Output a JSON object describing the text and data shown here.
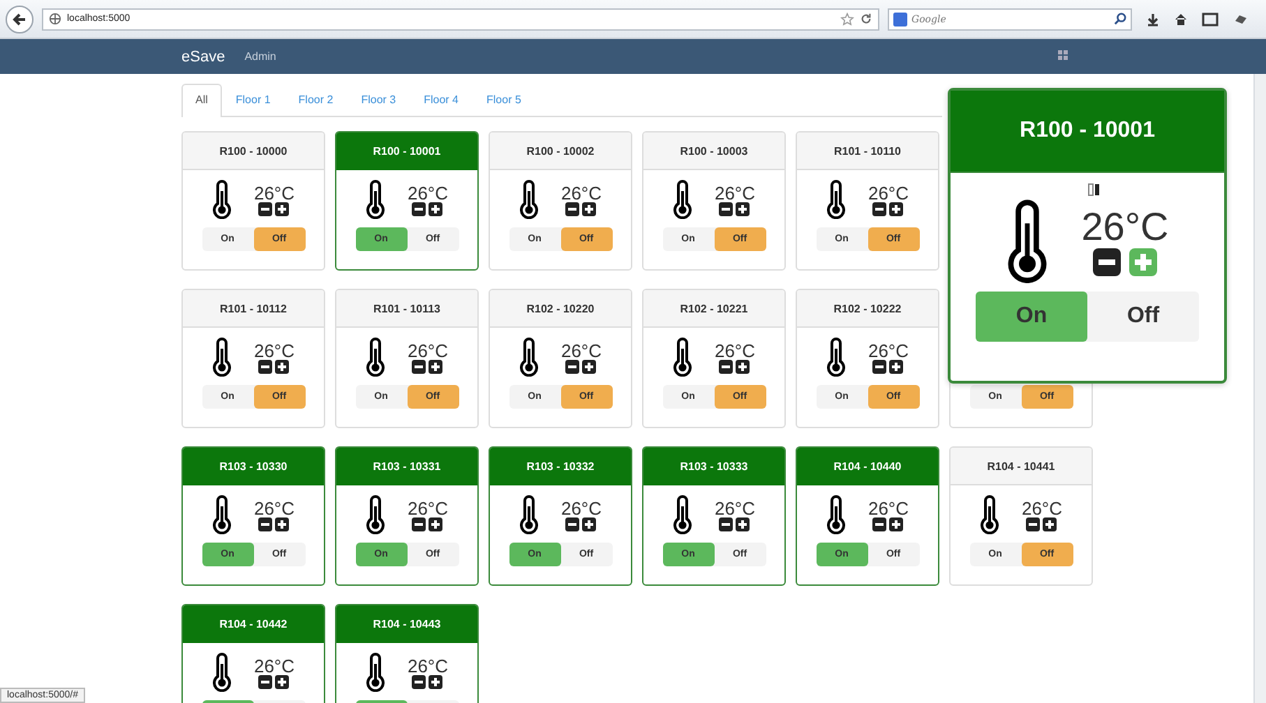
{
  "browser": {
    "address": "localhost:5000",
    "search_placeholder": "Google",
    "status": "localhost:5000/#"
  },
  "navbar": {
    "brand": "eSave",
    "links": [
      "Admin"
    ]
  },
  "tabs": [
    {
      "label": "All",
      "selected": true
    },
    {
      "label": "Floor 1",
      "selected": false
    },
    {
      "label": "Floor 2",
      "selected": false
    },
    {
      "label": "Floor 3",
      "selected": false
    },
    {
      "label": "Floor 4",
      "selected": false
    },
    {
      "label": "Floor 5",
      "selected": false
    }
  ],
  "rows": [
    [
      {
        "title": "R100 - 10000",
        "temperature": "26°C",
        "on_label": "On",
        "off_label": "Off",
        "on": false
      },
      {
        "title": "R100 - 10001",
        "temperature": "26°C",
        "on_label": "On",
        "off_label": "Off",
        "on": true
      },
      {
        "title": "R100 - 10002",
        "temperature": "26°C",
        "on_label": "On",
        "off_label": "Off",
        "on": false
      },
      {
        "title": "R100 - 10003",
        "temperature": "26°C",
        "on_label": "On",
        "off_label": "Off",
        "on": false
      },
      {
        "title": "R101 - 10110",
        "temperature": "26°C",
        "on_label": "On",
        "off_label": "Off",
        "on": false
      }
    ],
    [
      {
        "title": "R101 - 10112",
        "temperature": "26°C",
        "on_label": "On",
        "off_label": "Off",
        "on": false
      },
      {
        "title": "R101 - 10113",
        "temperature": "26°C",
        "on_label": "On",
        "off_label": "Off",
        "on": false
      },
      {
        "title": "R102 - 10220",
        "temperature": "26°C",
        "on_label": "On",
        "off_label": "Off",
        "on": false
      },
      {
        "title": "R102 - 10221",
        "temperature": "26°C",
        "on_label": "On",
        "off_label": "Off",
        "on": false
      },
      {
        "title": "R102 - 10222",
        "temperature": "26°C",
        "on_label": "On",
        "off_label": "Off",
        "on": false
      },
      {
        "on_label": "On",
        "off_label": "Off",
        "on": false
      }
    ],
    [
      {
        "title": "R103 - 10330",
        "temperature": "26°C",
        "on_label": "On",
        "off_label": "Off",
        "on": true
      },
      {
        "title": "R103 - 10331",
        "temperature": "26°C",
        "on_label": "On",
        "off_label": "Off",
        "on": true
      },
      {
        "title": "R103 - 10332",
        "temperature": "26°C",
        "on_label": "On",
        "off_label": "Off",
        "on": true
      },
      {
        "title": "R103 - 10333",
        "temperature": "26°C",
        "on_label": "On",
        "off_label": "Off",
        "on": true
      },
      {
        "title": "R104 - 10440",
        "temperature": "26°C",
        "on_label": "On",
        "off_label": "Off",
        "on": true
      },
      {
        "title": "R104 - 10441",
        "temperature": "26°C",
        "on_label": "On",
        "off_label": "Off",
        "on": false
      }
    ],
    [
      {
        "title": "R104 - 10442",
        "temperature": "26°C",
        "on": true
      },
      {
        "title": "R104 - 10443",
        "temperature": "26°C",
        "on": true
      }
    ]
  ],
  "popup": {
    "title": "R100 - 10001",
    "temperature": "26°C",
    "on_label": "On",
    "off_label": "Off",
    "on": true,
    "plus_hovered": true
  }
}
